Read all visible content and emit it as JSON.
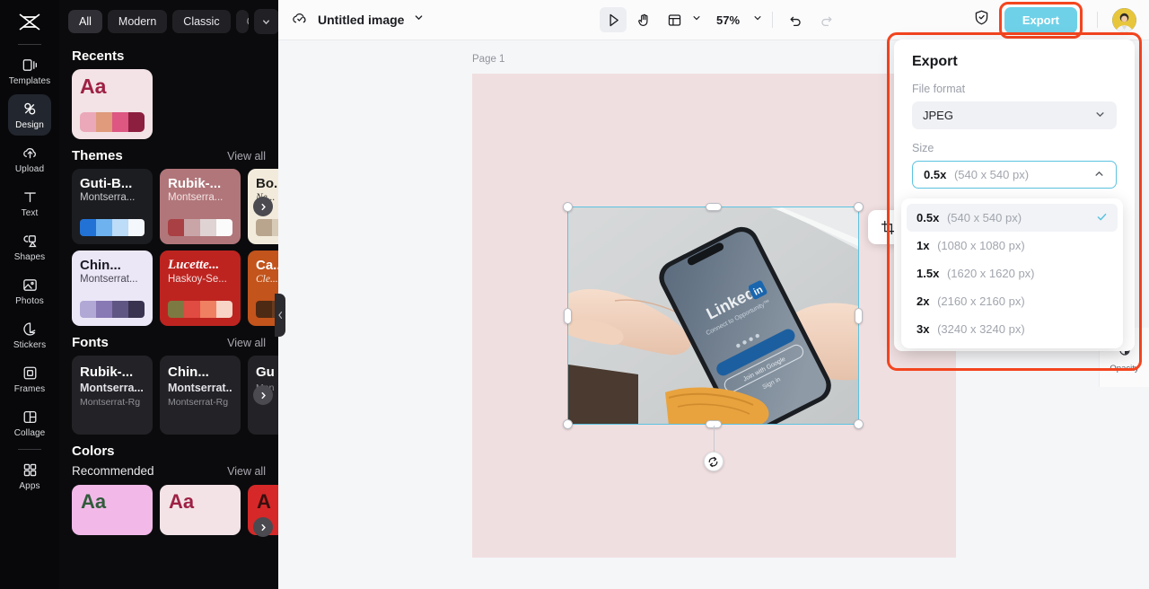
{
  "rail": {
    "logo_icon": "capcut-logo-icon",
    "items": [
      {
        "label": "Templates",
        "icon": "templates-icon",
        "active": false
      },
      {
        "label": "Design",
        "icon": "design-icon",
        "active": true
      },
      {
        "label": "Upload",
        "icon": "upload-cloud-icon",
        "active": false
      },
      {
        "label": "Text",
        "icon": "text-icon",
        "active": false
      },
      {
        "label": "Shapes",
        "icon": "shapes-icon",
        "active": false
      },
      {
        "label": "Photos",
        "icon": "photos-icon",
        "active": false
      },
      {
        "label": "Stickers",
        "icon": "stickers-icon",
        "active": false
      },
      {
        "label": "Frames",
        "icon": "frames-icon",
        "active": false
      },
      {
        "label": "Collage",
        "icon": "collage-icon",
        "active": false
      },
      {
        "label": "Apps",
        "icon": "apps-icon",
        "active": false
      }
    ]
  },
  "panel": {
    "chips": [
      "All",
      "Modern",
      "Classic",
      "Cool"
    ],
    "chip_active": "All",
    "chip_more_icon": "chevron-down-icon",
    "recents": {
      "title": "Recents",
      "card": {
        "sample": "Aa",
        "bg": "#f3e3e6",
        "text_color": "#9e2144",
        "swatches": [
          "#eba8b8",
          "#df9b7b",
          "#dd5782",
          "#8c1f40"
        ]
      }
    },
    "themes": {
      "title": "Themes",
      "view_all": "View all",
      "cards": [
        {
          "name": "Guti-B...",
          "font": "Montserra...",
          "bg": "#1c1d21",
          "title_color": "#ffffff",
          "sub_color": "#c9cace",
          "swatches": [
            "#2272d6",
            "#6eb2ef",
            "#bcdcf7",
            "#f4f7fb"
          ]
        },
        {
          "name": "Rubik-...",
          "font": "Montserra...",
          "bg": "#b1767a",
          "title_color": "#ffffff",
          "sub_color": "#f2e3e3",
          "swatches": [
            "#a94044",
            "#c9a5a8",
            "#e0d3d4",
            "#fbfbfb"
          ]
        },
        {
          "name": "Bo...",
          "font": "Ne...",
          "bg": "#f2ebdc",
          "title_color": "#20201c",
          "sub_color": "#35332c",
          "swatches": [
            "#b9a58e",
            "#d7cbb7",
            "#e8e0d0",
            "#f7f3ea"
          ]
        },
        {
          "name": "Chin...",
          "font": "Montserrat...",
          "bg": "#ece7f7",
          "title_color": "#1b1b23",
          "sub_color": "#4a4a55",
          "swatches": [
            "#b2a8d6",
            "#8878b4",
            "#605683",
            "#3a3350"
          ]
        },
        {
          "name": "Lucette...",
          "font": "Haskoy-Se...",
          "bg": "#bd2420",
          "title_color": "#ffffff",
          "sub_color": "#f4dede",
          "swatches": [
            "#7c7a42",
            "#e04b42",
            "#ef8061",
            "#f7d4c6"
          ]
        },
        {
          "name": "Ca...",
          "font": "Cle...",
          "bg": "#c2541c",
          "title_color": "#ffffff",
          "sub_color": "#fbe9d9",
          "swatches": [
            "#4d2a14",
            "#6a3a1c",
            "#8a4d22",
            "#a35c28"
          ]
        }
      ],
      "next_icon": "chevron-right-icon"
    },
    "fonts": {
      "title": "Fonts",
      "view_all": "View all",
      "cards": [
        {
          "l1": "Rubik-...",
          "l2": "Montserra...",
          "l3": "Montserrat-Rg"
        },
        {
          "l1": "Chin...",
          "l2": "Montserrat...",
          "l3": "Montserrat-Rg"
        },
        {
          "l1": "Gu",
          "l2": "",
          "l3": "Mon"
        }
      ],
      "next_icon": "chevron-right-icon"
    },
    "colors": {
      "title": "Colors",
      "recommended_label": "Recommended",
      "view_all": "View all",
      "cards": [
        {
          "sample": "Aa",
          "bg": "#f2b8e8",
          "text_color": "#2f5c3a"
        },
        {
          "sample": "Aa",
          "bg": "#f3e3e6",
          "text_color": "#9e2144"
        },
        {
          "sample": "A",
          "bg": "#d62828",
          "text_color": "#3a0f0f"
        }
      ],
      "next_icon": "chevron-right-icon"
    },
    "collapse_icon": "chevron-left-icon"
  },
  "topbar": {
    "cloud_icon": "cloud-check-icon",
    "doc_title": "Untitled image",
    "title_caret_icon": "chevron-down-icon",
    "tools": [
      {
        "name": "select-tool",
        "icon": "cursor-arrow-icon",
        "selected": true
      },
      {
        "name": "hand-tool",
        "icon": "hand-icon",
        "selected": false
      },
      {
        "name": "layout-tool",
        "icon": "layout-panel-icon",
        "selected": false
      }
    ],
    "layout_caret_icon": "chevron-down-icon",
    "zoom_value": "57%",
    "zoom_caret_icon": "chevron-down-icon",
    "undo_icon": "undo-arrow-icon",
    "redo_icon": "redo-arrow-icon",
    "shield_icon": "shield-check-icon",
    "export_label": "Export",
    "export_color": "#6fd1e8",
    "highlight_color": "#f4451f",
    "avatar_name": "user-avatar"
  },
  "canvas": {
    "page_label": "Page 1",
    "page_bg": "#f0dfe1",
    "selection_color": "#5cc3e0",
    "float_toolbar": [
      {
        "name": "crop-button",
        "icon": "crop-icon"
      },
      {
        "name": "replace-button",
        "icon": "shuffle-nodes-icon"
      },
      {
        "name": "duplicate-button",
        "icon": "duplicate-plus-icon"
      },
      {
        "name": "more-button",
        "icon": "ellipsis-icon"
      }
    ],
    "rotate_icon": "rotate-icon",
    "photo_alt": "hand-holding-phone-linkedin-photo",
    "opacity_label": "Opacity",
    "opacity_icon": "opacity-droplet-icon"
  },
  "export_panel": {
    "title": "Export",
    "file_format_label": "File format",
    "file_format_value": "JPEG",
    "format_caret_icon": "chevron-down-icon",
    "size_label": "Size",
    "size_value_mult": "0.5x",
    "size_value_dims": "(540 x 540 px)",
    "size_caret_icon": "chevron-up-icon",
    "options": [
      {
        "mult": "0.5x",
        "dims": "(540 x 540 px)",
        "selected": true
      },
      {
        "mult": "1x",
        "dims": "(1080 x 1080 px)",
        "selected": false
      },
      {
        "mult": "1.5x",
        "dims": "(1620 x 1620 px)",
        "selected": false
      },
      {
        "mult": "2x",
        "dims": "(2160 x 2160 px)",
        "selected": false
      },
      {
        "mult": "3x",
        "dims": "(3240 x 3240 px)",
        "selected": false
      }
    ],
    "check_icon": "check-icon"
  }
}
